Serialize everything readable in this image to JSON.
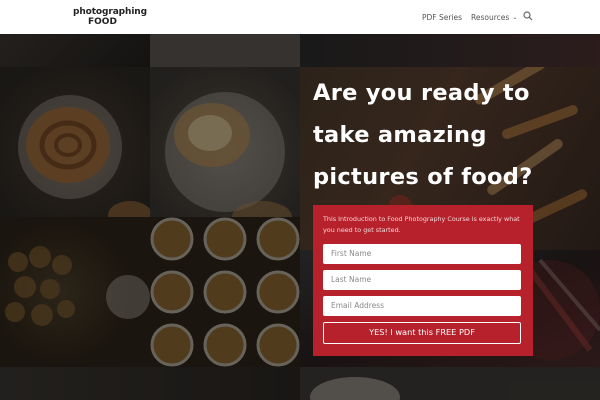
{
  "header": {
    "logo_line1": "photographing",
    "logo_line2": "FOOD",
    "nav": [
      {
        "label": "PDF Series"
      },
      {
        "label": "Resources",
        "has_dropdown": true
      }
    ],
    "search_icon": "search-icon"
  },
  "hero": {
    "headline_lines": [
      "Are you ready to",
      "take amazing",
      "pictures of food?"
    ]
  },
  "form": {
    "intro": "This Introduction to Food Photography Course is exactly what you need to get started.",
    "fields": [
      {
        "placeholder": "First Name"
      },
      {
        "placeholder": "Last Name"
      },
      {
        "placeholder": "Email Address"
      }
    ],
    "submit_label": "YES! I want this FREE PDF"
  },
  "colors": {
    "panel": "#b7212c",
    "header_bg": "#ffffff",
    "text_white": "#ffffff"
  }
}
